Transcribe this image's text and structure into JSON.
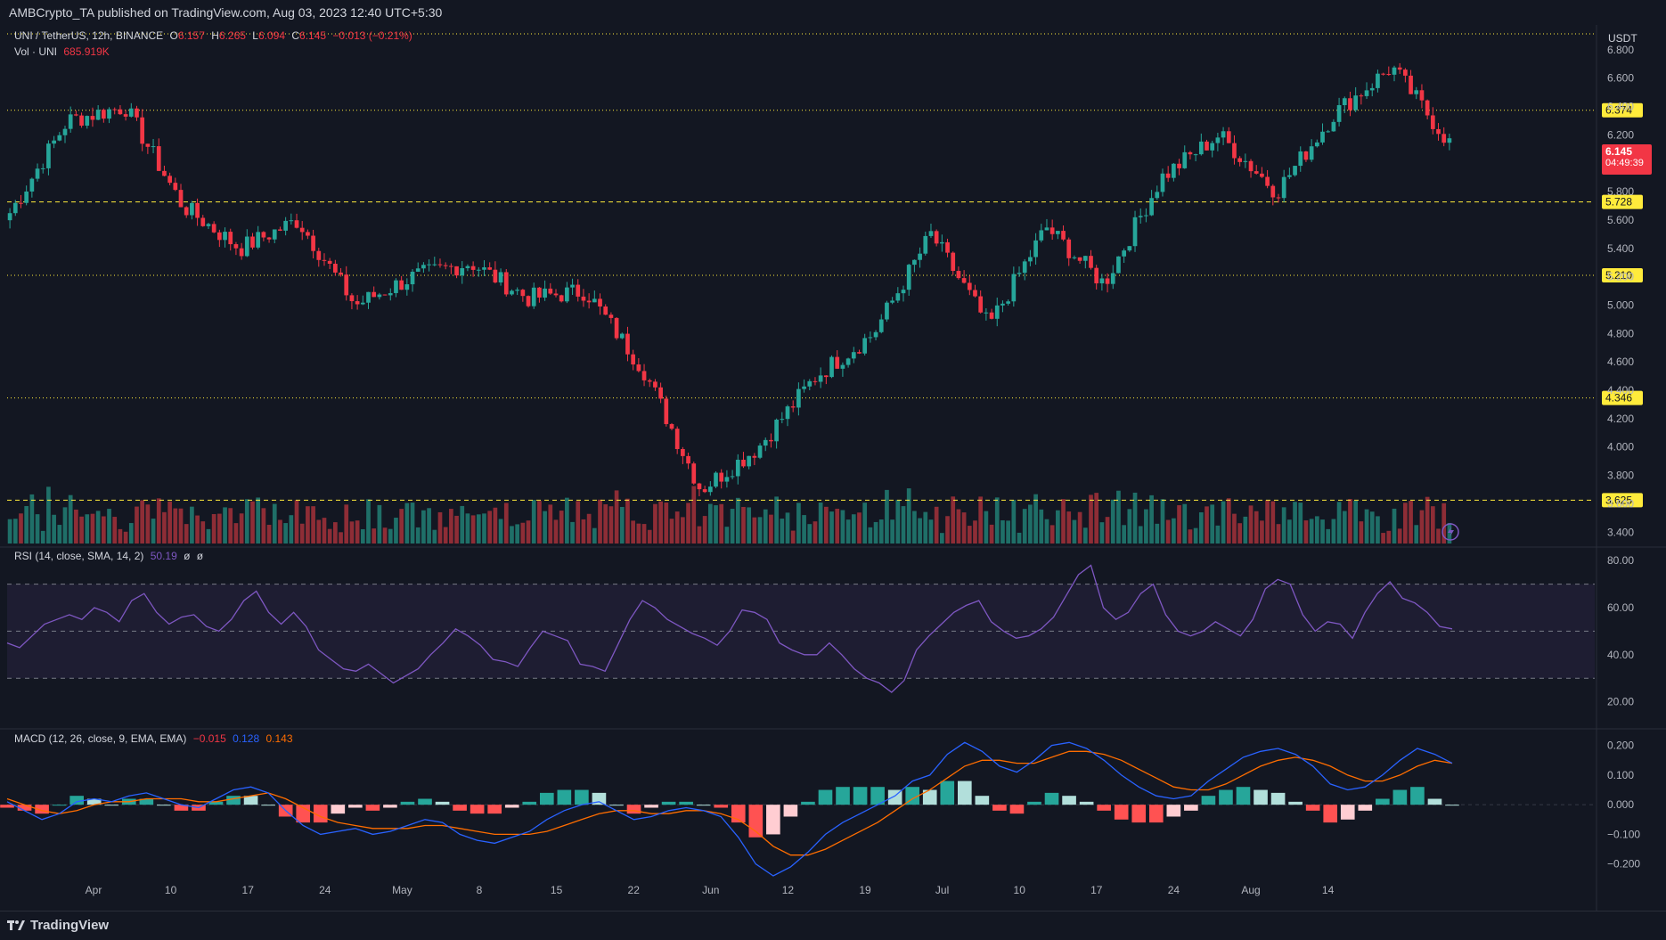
{
  "publisher": "AMBCrypto_TA published on TradingView.com, Aug 03, 2023 12:40 UTC+5:30",
  "brand": "TradingView",
  "symbol_legend": {
    "title": "UNI / TetherUS, 12h, BINANCE",
    "o_label": "O",
    "o": "6.157",
    "h_label": "H",
    "h": "6.265",
    "l_label": "L",
    "l": "6.094",
    "c_label": "C",
    "c": "6.145",
    "change": "−0.013 (−0.21%)"
  },
  "volume_legend": {
    "label": "Vol · UNI",
    "value": "685.919K"
  },
  "rsi_legend": {
    "label": "RSI (14, close, SMA, 14, 2)",
    "value": "50.19",
    "extra1": "ø",
    "extra2": "ø"
  },
  "macd_legend": {
    "label": "MACD (12, 26, close, 9, EMA, EMA)",
    "hist": "−0.015",
    "macd": "0.128",
    "signal": "0.143"
  },
  "currency": "USDT",
  "last_price": "6.145",
  "countdown": "04:49:39",
  "colors": {
    "background": "#131722",
    "up": "#26a69a",
    "down": "#f23645",
    "level_line": "#ffeb3b",
    "rsi": "#7e57c2",
    "macd": "#2962ff",
    "signal": "#ff6d00",
    "hist_up_strong": "#26a69a",
    "hist_up_weak": "#b2dfdb",
    "hist_down_strong": "#ff5252",
    "hist_down_weak": "#ffcdd2"
  },
  "chart_data": {
    "type": "candlestick",
    "timeframe": "12h",
    "price_axis": {
      "ticks": [
        "6.800",
        "6.600",
        "6.400",
        "6.200",
        "6.000",
        "5.800",
        "5.600",
        "5.400",
        "5.200",
        "5.000",
        "4.800",
        "4.600",
        "4.400",
        "4.200",
        "4.000",
        "3.800",
        "3.600",
        "3.400"
      ],
      "range": [
        3.32,
        6.95
      ]
    },
    "levels": [
      {
        "value": 6.374,
        "label": "6.374"
      },
      {
        "value": 5.728,
        "label": "5.728"
      },
      {
        "value": 5.21,
        "label": "5.210"
      },
      {
        "value": 4.346,
        "label": "4.346"
      },
      {
        "value": 3.625,
        "label": "3.625"
      }
    ],
    "x_ticks": [
      "Apr",
      "10",
      "17",
      "24",
      "May",
      "8",
      "15",
      "22",
      "Jun",
      "12",
      "19",
      "Jul",
      "10",
      "17",
      "24",
      "Aug",
      "14"
    ],
    "key_points": [
      {
        "label": "late Mar",
        "close": 5.65
      },
      {
        "label": "Apr 5",
        "close": 6.3
      },
      {
        "label": "Apr 14",
        "close": 6.4
      },
      {
        "label": "Apr 19",
        "close": 5.7
      },
      {
        "label": "Apr 24",
        "close": 5.4
      },
      {
        "label": "May 1",
        "close": 5.6
      },
      {
        "label": "May 10",
        "close": 5.0
      },
      {
        "label": "May 18",
        "close": 5.2
      },
      {
        "label": "May 22",
        "close": 5.3
      },
      {
        "label": "May 28",
        "close": 5.05
      },
      {
        "label": "Jun 3",
        "close": 5.1
      },
      {
        "label": "Jun 8",
        "close": 4.55
      },
      {
        "label": "Jun 10",
        "close": 3.7
      },
      {
        "label": "Jun 11",
        "close": 4.0
      },
      {
        "label": "Jun 18",
        "close": 4.5
      },
      {
        "label": "Jun 25",
        "close": 4.8
      },
      {
        "label": "Jun 27",
        "close": 5.5
      },
      {
        "label": "Jun 30",
        "close": 4.85
      },
      {
        "label": "Jul 2",
        "close": 5.55
      },
      {
        "label": "Jul 10",
        "close": 5.15
      },
      {
        "label": "Jul 13",
        "close": 5.9
      },
      {
        "label": "Jul 20",
        "close": 6.2
      },
      {
        "label": "Jul 24",
        "close": 5.8
      },
      {
        "label": "Jul 28",
        "close": 6.35
      },
      {
        "label": "Aug 1",
        "close": 6.68
      },
      {
        "label": "Aug 3",
        "close": 6.145
      }
    ],
    "rsi": {
      "axis_ticks": [
        "80.00",
        "60.00",
        "40.00",
        "20.00"
      ],
      "bands": [
        30,
        50,
        70
      ],
      "values": [
        45,
        43,
        48,
        53,
        55,
        57,
        55,
        60,
        58,
        54,
        63,
        66,
        58,
        53,
        56,
        57,
        52,
        50,
        55,
        63,
        67,
        58,
        53,
        58,
        52,
        42,
        38,
        34,
        33,
        36,
        32,
        28,
        31,
        34,
        40,
        45,
        51,
        48,
        44,
        38,
        37,
        35,
        43,
        50,
        48,
        46,
        36,
        35,
        33,
        44,
        55,
        63,
        60,
        55,
        52,
        49,
        47,
        44,
        50,
        59,
        58,
        55,
        45,
        42,
        40,
        40,
        45,
        40,
        34,
        30,
        28,
        24,
        29,
        42,
        48,
        53,
        58,
        61,
        63,
        54,
        50,
        47,
        48,
        51,
        56,
        65,
        74,
        78,
        60,
        55,
        58,
        66,
        70,
        57,
        50,
        48,
        50,
        54,
        51,
        48,
        55,
        68,
        72,
        70,
        57,
        50,
        54,
        53,
        47,
        58,
        66,
        71,
        64,
        62,
        58,
        52,
        51
      ]
    },
    "macd": {
      "axis_ticks": [
        "0.200",
        "0.100",
        "0.000",
        "−0.100",
        "−0.200"
      ],
      "macd_values": [
        0.01,
        -0.02,
        -0.05,
        -0.03,
        0.01,
        0.02,
        0.01,
        0.03,
        0.04,
        0.02,
        0.0,
        -0.01,
        0.02,
        0.05,
        0.06,
        0.04,
        -0.02,
        -0.07,
        -0.1,
        -0.09,
        -0.08,
        -0.1,
        -0.09,
        -0.07,
        -0.05,
        -0.06,
        -0.1,
        -0.12,
        -0.13,
        -0.11,
        -0.09,
        -0.05,
        -0.02,
        0.0,
        0.01,
        -0.02,
        -0.05,
        -0.04,
        -0.02,
        -0.01,
        -0.02,
        -0.04,
        -0.11,
        -0.2,
        -0.24,
        -0.21,
        -0.16,
        -0.1,
        -0.06,
        -0.03,
        0.0,
        0.03,
        0.08,
        0.1,
        0.17,
        0.21,
        0.18,
        0.13,
        0.11,
        0.15,
        0.2,
        0.21,
        0.19,
        0.15,
        0.1,
        0.06,
        0.03,
        0.02,
        0.03,
        0.08,
        0.12,
        0.16,
        0.18,
        0.19,
        0.17,
        0.13,
        0.07,
        0.05,
        0.06,
        0.1,
        0.15,
        0.19,
        0.17,
        0.14
      ],
      "signal_values": [
        0.02,
        0.0,
        -0.02,
        -0.03,
        -0.02,
        0.0,
        0.01,
        0.01,
        0.02,
        0.02,
        0.02,
        0.01,
        0.01,
        0.02,
        0.03,
        0.04,
        0.02,
        -0.01,
        -0.04,
        -0.06,
        -0.07,
        -0.08,
        -0.08,
        -0.08,
        -0.07,
        -0.07,
        -0.08,
        -0.09,
        -0.1,
        -0.1,
        -0.1,
        -0.09,
        -0.07,
        -0.05,
        -0.03,
        -0.02,
        -0.02,
        -0.03,
        -0.03,
        -0.02,
        -0.02,
        -0.03,
        -0.05,
        -0.09,
        -0.14,
        -0.17,
        -0.17,
        -0.15,
        -0.12,
        -0.09,
        -0.06,
        -0.02,
        0.02,
        0.05,
        0.09,
        0.13,
        0.15,
        0.15,
        0.14,
        0.14,
        0.16,
        0.18,
        0.18,
        0.17,
        0.15,
        0.12,
        0.09,
        0.06,
        0.05,
        0.05,
        0.07,
        0.1,
        0.13,
        0.15,
        0.16,
        0.15,
        0.13,
        0.1,
        0.08,
        0.08,
        0.1,
        0.13,
        0.15,
        0.14
      ]
    }
  }
}
